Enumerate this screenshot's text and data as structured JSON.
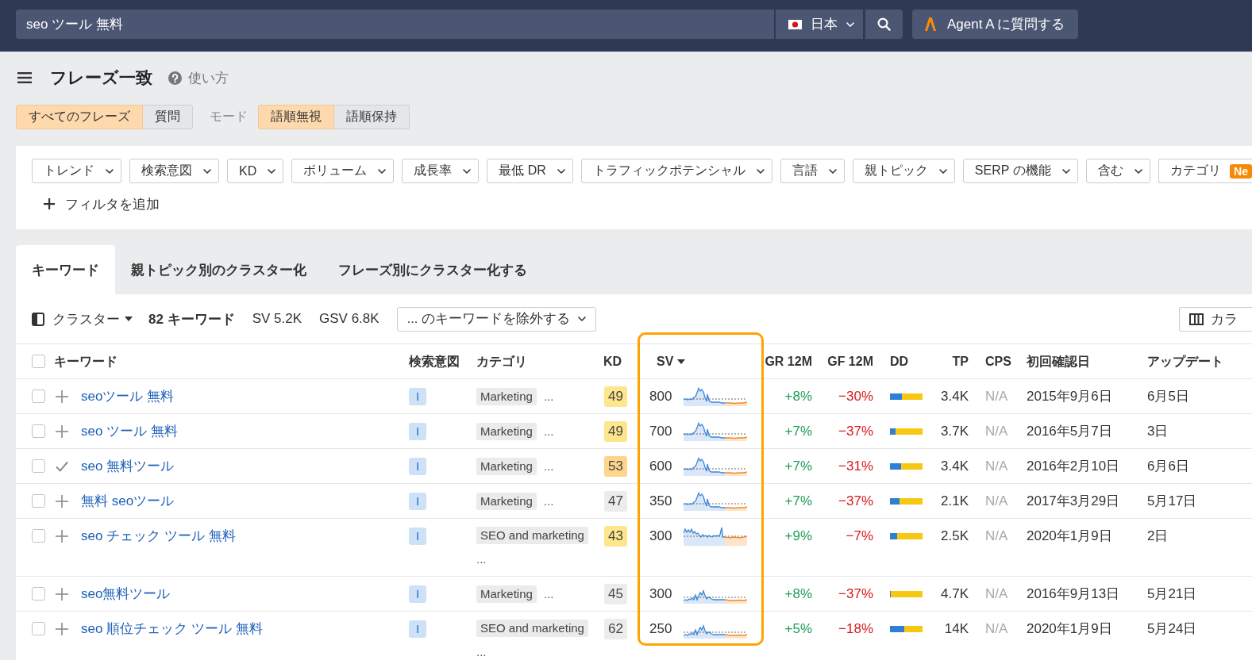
{
  "search_bar": {
    "query": "seo ツール 無料",
    "country": "日本",
    "agent_button": "Agent A に質問する"
  },
  "header": {
    "title": "フレーズ一致",
    "help_link": "使い方"
  },
  "phrase_types": [
    {
      "label": "すべてのフレーズ",
      "selected": true
    },
    {
      "label": "質問",
      "selected": false
    }
  ],
  "mode": {
    "label": "モード",
    "options": [
      {
        "label": "語順無視",
        "selected": true
      },
      {
        "label": "語順保持",
        "selected": false
      }
    ]
  },
  "filters": [
    {
      "label": "トレンド"
    },
    {
      "label": "検索意図"
    },
    {
      "label": "KD"
    },
    {
      "label": "ボリューム"
    },
    {
      "label": "成長率"
    },
    {
      "label": "最低 DR"
    },
    {
      "label": "トラフィックポテンシャル"
    },
    {
      "label": "言語"
    },
    {
      "label": "親トピック"
    },
    {
      "label": "SERP の機能"
    },
    {
      "label": "含む"
    },
    {
      "label": "カテゴリ",
      "badge": "Ne"
    }
  ],
  "add_filter": "フィルタを追加",
  "tabs": [
    {
      "label": "キーワード",
      "selected": true
    },
    {
      "label": "親トピック別のクラスター化",
      "selected": false
    },
    {
      "label": "フレーズ別にクラスター化する",
      "selected": false
    }
  ],
  "toolbar": {
    "cluster_button": "クラスター",
    "keyword_count": "82 キーワード",
    "sv_total": "SV 5.2K",
    "gsv_total": "GSV 6.8K",
    "exclude_dropdown": "... のキーワードを除外する",
    "columns_button": "カラ"
  },
  "table": {
    "select_all": {
      "checked": false
    },
    "columns": [
      {
        "label": "キーワード",
        "sorted": false,
        "highlighted": false
      },
      {
        "label": "検索意図",
        "sorted": false,
        "highlighted": false
      },
      {
        "label": "カテゴリ",
        "sorted": false,
        "highlighted": false
      },
      {
        "label": "KD",
        "sorted": false,
        "highlighted": false
      },
      {
        "label": "SV",
        "sorted": true,
        "highlighted": true
      },
      {
        "label": "GR 12M",
        "sorted": false,
        "highlighted": false
      },
      {
        "label": "GF 12M",
        "sorted": false,
        "highlighted": false
      },
      {
        "label": "DD",
        "sorted": false,
        "highlighted": false
      },
      {
        "label": "TP",
        "sorted": false,
        "highlighted": false
      },
      {
        "label": "CPS",
        "sorted": false,
        "highlighted": false
      },
      {
        "label": "初回確認日",
        "sorted": false,
        "highlighted": false
      },
      {
        "label": "アップデート",
        "sorted": false,
        "highlighted": false
      }
    ],
    "rows": [
      {
        "checked": false,
        "added": false,
        "keyword": "seoツール 無料",
        "intent": "I",
        "category": "Marketing",
        "category_more": "...",
        "kd": {
          "value": "49",
          "color": "#fde68c"
        },
        "sv": "800",
        "gr": "+8%",
        "gf": "−30%",
        "dd": {
          "level": 0.37
        },
        "tp": "3.4K",
        "cps": "N/A",
        "first_seen": "2015年9月6日",
        "updated": "6月5日"
      },
      {
        "checked": false,
        "added": false,
        "keyword": "seo ツール 無料",
        "intent": "I",
        "category": "Marketing",
        "category_more": "...",
        "kd": {
          "value": "49",
          "color": "#fde68c"
        },
        "sv": "700",
        "gr": "+7%",
        "gf": "−37%",
        "dd": {
          "level": 0.16
        },
        "tp": "3.7K",
        "cps": "N/A",
        "first_seen": "2016年5月7日",
        "updated": "3日"
      },
      {
        "checked": false,
        "added": true,
        "keyword": "seo 無料ツール",
        "intent": "I",
        "category": "Marketing",
        "category_more": "...",
        "kd": {
          "value": "53",
          "color": "#fdd58b"
        },
        "sv": "600",
        "gr": "+7%",
        "gf": "−31%",
        "dd": {
          "level": 0.33
        },
        "tp": "3.4K",
        "cps": "N/A",
        "first_seen": "2016年2月10日",
        "updated": "6月6日"
      },
      {
        "checked": false,
        "added": false,
        "keyword": "無料 seoツール",
        "intent": "I",
        "category": "Marketing",
        "category_more": "...",
        "kd": {
          "value": "47",
          "color": "#ececec"
        },
        "sv": "350",
        "gr": "+7%",
        "gf": "−37%",
        "dd": {
          "level": 0.29
        },
        "tp": "2.1K",
        "cps": "N/A",
        "first_seen": "2017年3月29日",
        "updated": "5月17日"
      },
      {
        "checked": false,
        "added": false,
        "keyword": "seo チェック ツール 無料",
        "intent": "I",
        "category": "SEO and marketing",
        "category_more": "...",
        "kd": {
          "value": "43",
          "color": "#fde68c"
        },
        "sv": "300",
        "gr": "+9%",
        "gf": "−7%",
        "dd": {
          "level": 0.23
        },
        "tp": "2.5K",
        "cps": "N/A",
        "first_seen": "2020年1月9日",
        "updated": "2日"
      },
      {
        "checked": false,
        "added": false,
        "keyword": "seo無料ツール",
        "intent": "I",
        "category": "Marketing",
        "category_more": "...",
        "kd": {
          "value": "45",
          "color": "#ececec"
        },
        "sv": "300",
        "gr": "+8%",
        "gf": "−37%",
        "dd": {
          "level": 0.02
        },
        "tp": "4.7K",
        "cps": "N/A",
        "first_seen": "2016年9月13日",
        "updated": "5月21日"
      },
      {
        "checked": false,
        "added": false,
        "keyword": "seo 順位チェック ツール 無料",
        "intent": "I",
        "category": "SEO and marketing",
        "category_more": "...",
        "kd": {
          "value": "62",
          "color": "#ececec"
        },
        "sv": "250",
        "gr": "+5%",
        "gf": "−18%",
        "dd": {
          "level": 0.43
        },
        "tp": "14K",
        "cps": "N/A",
        "first_seen": "2020年1月9日",
        "updated": "5月24日"
      }
    ]
  }
}
